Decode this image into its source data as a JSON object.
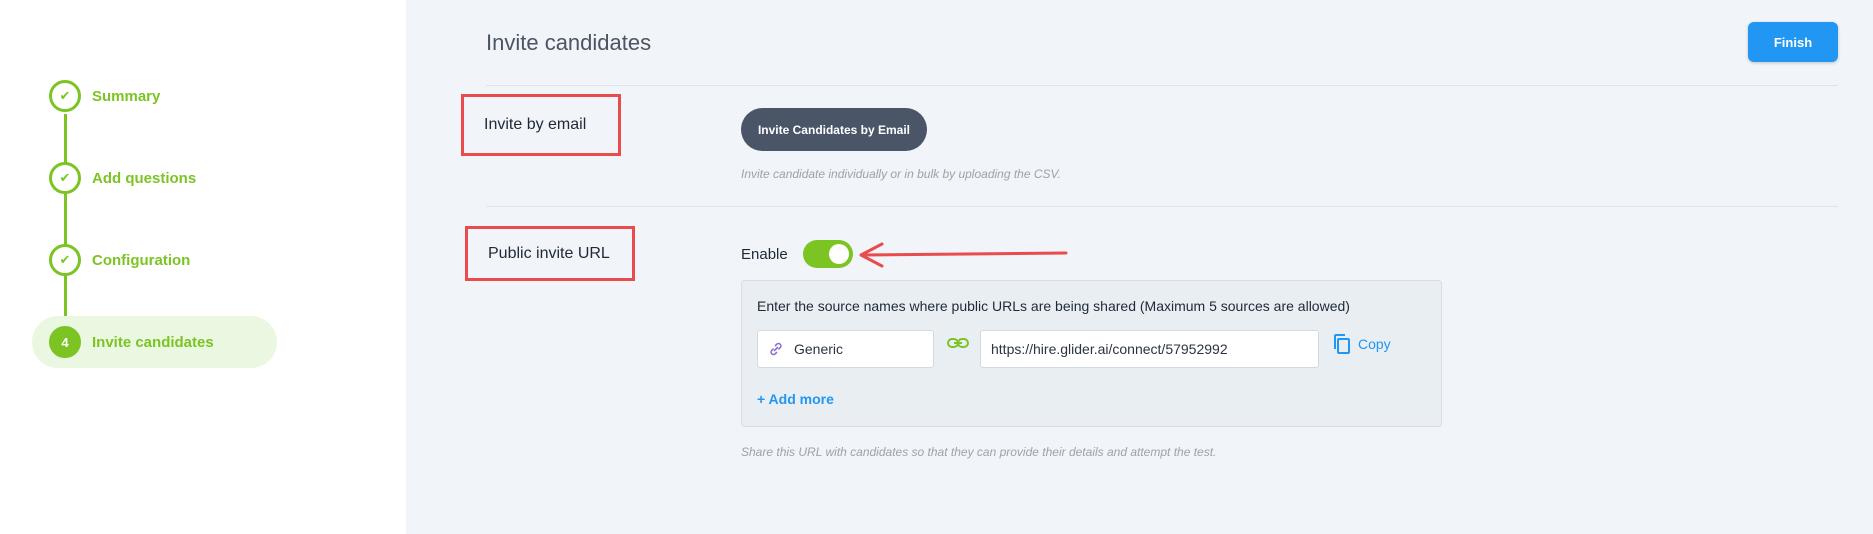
{
  "sidebar": {
    "steps": [
      {
        "label": "Summary",
        "marker": "✔"
      },
      {
        "label": "Add questions",
        "marker": "✔"
      },
      {
        "label": "Configuration",
        "marker": "✔"
      },
      {
        "label": "Invite candidates",
        "marker": "4"
      }
    ],
    "active_step": 4
  },
  "header": {
    "title": "Invite candidates",
    "finish_label": "Finish"
  },
  "invite_email": {
    "label": "Invite by email",
    "button_label": "Invite Candidates by Email",
    "hint": "Invite candidate individually or in bulk by uploading the CSV."
  },
  "public_url": {
    "label": "Public invite URL",
    "enable_label": "Enable",
    "enabled": true,
    "instructions": "Enter the source names where public URLs are being shared (Maximum 5 sources are allowed)",
    "source_name": "Generic",
    "url": "https://hire.glider.ai/connect/57952992",
    "copy_label": "Copy",
    "add_more_label": "+ Add more",
    "hint": "Share this URL with candidates so that they can provide their details and attempt the test."
  },
  "colors": {
    "accent_green": "#7cc424",
    "primary_blue": "#2196f3",
    "annotation_red": "#e84c4c",
    "dark_button": "#4a5568"
  },
  "icons": [
    "check-icon",
    "link-icon",
    "chain-link-icon",
    "copy-icon",
    "annotation-arrow"
  ]
}
